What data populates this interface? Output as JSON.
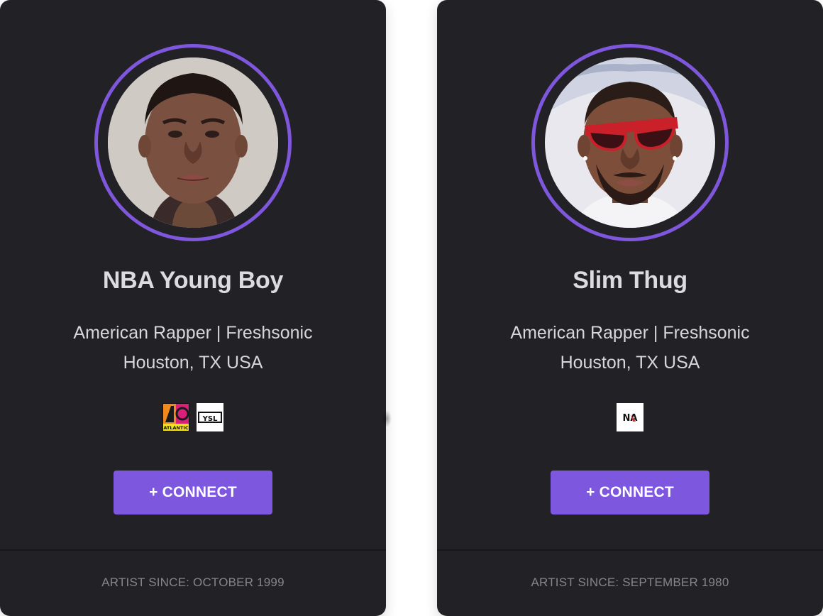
{
  "cards": [
    {
      "name": "NBA Young Boy",
      "subtitle": "American Rapper | Freshsonic",
      "location": "Houston, TX USA",
      "labels": [
        {
          "icon": "atlantic-records-logo",
          "text": "ATLANTIC"
        },
        {
          "icon": "ysl-records-logo",
          "text": "YSL"
        }
      ],
      "connect_label": "+ CONNECT",
      "since": "ARTIST SINCE: OCTOBER 1999"
    },
    {
      "name": "Slim Thug",
      "subtitle": "American Rapper | Freshsonic",
      "location": "Houston, TX USA",
      "labels": [
        {
          "icon": "na-label-logo",
          "text": "NA"
        }
      ],
      "connect_label": "+ CONNECT",
      "since": "ARTIST SINCE: SEPTEMBER 1980"
    }
  ],
  "colors": {
    "card_bg": "#222126",
    "accent": "#7e57dc",
    "name_text": "#dcdbe0",
    "meta_text": "#d7d6da",
    "since_text": "#86858c"
  }
}
